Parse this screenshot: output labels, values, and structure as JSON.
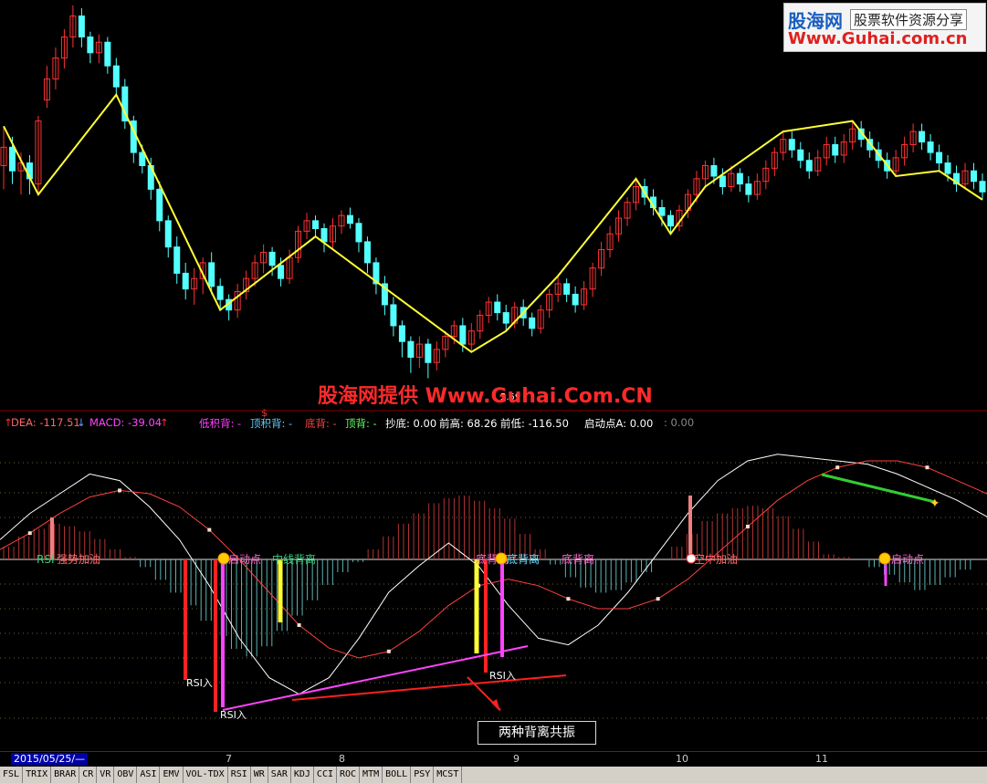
{
  "logo": {
    "brand": "股海网",
    "tag": "股票软件资源分享",
    "url": "Www.Guhai.com.cn"
  },
  "watermark": "股海网提供 Www.Guhai.Com.CN",
  "price_label": "5.59",
  "signal_marker": "$",
  "infobar": {
    "dea": "DEA: -117.51",
    "macd": "MACD: -39.04",
    "low_stack": "低积背: -",
    "top_stack": "顶积背: -",
    "bottom_div": "底背: -",
    "top_div": "顶背: -",
    "chaodi": "抄底: 0.00",
    "qiangao": "前高: 68.26",
    "qiandi": "前低: -116.50",
    "qidong": "启动点A: 0.00",
    "extra": ": 0.00"
  },
  "annotations": {
    "rsi_in_1": "RSI入",
    "rsi_in_2": "RSI入",
    "rsi_in_3": "RSI入",
    "note": "两种背离共振"
  },
  "signal_labels": [
    {
      "text": "RSI",
      "color": "#33d17a"
    },
    {
      "text": "强势加油",
      "color": "#ff6b6b"
    },
    {
      "text": "启动点",
      "color": "#ff66cc"
    },
    {
      "text": "中线背离",
      "color": "#33d17a"
    },
    {
      "text": "底背离",
      "color": "#ff66cc"
    },
    {
      "text": "底背离",
      "color": "#66e0ff"
    },
    {
      "text": "底背离",
      "color": "#ff66cc"
    },
    {
      "text": "空中加油",
      "color": "#ff6b6b"
    },
    {
      "text": "启动点",
      "color": "#ff66cc"
    }
  ],
  "date_axis": {
    "start": "2015/05/25/—",
    "ticks": [
      "7",
      "8",
      "9",
      "10",
      "11"
    ]
  },
  "tabs": [
    "FSL",
    "TRIX",
    "BRAR",
    "CR",
    "VR",
    "OBV",
    "ASI",
    "EMV",
    "VOL-TDX",
    "RSI",
    "WR",
    "SAR",
    "KDJ",
    "CCI",
    "ROC",
    "MTM",
    "BOLL",
    "PSY",
    "MCST"
  ],
  "colors": {
    "up": "#ff3232",
    "down": "#54ffff",
    "zigzag": "#ffff33",
    "diff": "#ffffff",
    "dea": "#ff4040",
    "divergence": "#ff44ff",
    "trend": "#ff2020"
  },
  "chart_data": [
    {
      "type": "candlestick",
      "title": "",
      "zigzag": [
        0,
        4,
        13,
        25,
        36,
        54,
        58,
        64,
        73,
        77,
        81,
        90,
        98,
        103,
        108,
        113
      ],
      "candles": [
        [
          5.95,
          6.02,
          6.1,
          5.86
        ],
        [
          6.02,
          5.93,
          6.06,
          5.88
        ],
        [
          5.93,
          5.96,
          6.0,
          5.84
        ],
        [
          5.96,
          5.9,
          5.99,
          5.84
        ],
        [
          5.88,
          6.12,
          6.14,
          5.84
        ],
        [
          6.2,
          6.28,
          6.33,
          6.17
        ],
        [
          6.28,
          6.36,
          6.4,
          6.24
        ],
        [
          6.36,
          6.44,
          6.47,
          6.32
        ],
        [
          6.44,
          6.52,
          6.56,
          6.4
        ],
        [
          6.52,
          6.44,
          6.55,
          6.4
        ],
        [
          6.44,
          6.38,
          6.46,
          6.34
        ],
        [
          6.38,
          6.42,
          6.45,
          6.34
        ],
        [
          6.42,
          6.33,
          6.44,
          6.3
        ],
        [
          6.33,
          6.25,
          6.36,
          6.22
        ],
        [
          6.25,
          6.12,
          6.28,
          6.09
        ],
        [
          6.12,
          6.0,
          6.14,
          5.96
        ],
        [
          6.0,
          5.95,
          6.03,
          5.92
        ],
        [
          5.95,
          5.86,
          5.98,
          5.82
        ],
        [
          5.86,
          5.74,
          5.89,
          5.7
        ],
        [
          5.74,
          5.64,
          5.76,
          5.6
        ],
        [
          5.64,
          5.54,
          5.68,
          5.5
        ],
        [
          5.54,
          5.48,
          5.58,
          5.44
        ],
        [
          5.48,
          5.52,
          5.56,
          5.42
        ],
        [
          5.52,
          5.58,
          5.6,
          5.46
        ],
        [
          5.58,
          5.49,
          5.62,
          5.46
        ],
        [
          5.49,
          5.44,
          5.52,
          5.4
        ],
        [
          5.44,
          5.4,
          5.46,
          5.36
        ],
        [
          5.4,
          5.47,
          5.5,
          5.37
        ],
        [
          5.47,
          5.52,
          5.55,
          5.44
        ],
        [
          5.52,
          5.58,
          5.61,
          5.49
        ],
        [
          5.58,
          5.62,
          5.65,
          5.54
        ],
        [
          5.62,
          5.57,
          5.64,
          5.53
        ],
        [
          5.57,
          5.52,
          5.6,
          5.49
        ],
        [
          5.52,
          5.6,
          5.63,
          5.5
        ],
        [
          5.6,
          5.7,
          5.72,
          5.58
        ],
        [
          5.7,
          5.74,
          5.77,
          5.67
        ],
        [
          5.74,
          5.71,
          5.76,
          5.68
        ],
        [
          5.71,
          5.66,
          5.73,
          5.62
        ],
        [
          5.66,
          5.72,
          5.75,
          5.63
        ],
        [
          5.72,
          5.76,
          5.78,
          5.69
        ],
        [
          5.76,
          5.73,
          5.79,
          5.71
        ],
        [
          5.73,
          5.66,
          5.75,
          5.62
        ],
        [
          5.66,
          5.58,
          5.68,
          5.54
        ],
        [
          5.58,
          5.5,
          5.6,
          5.46
        ],
        [
          5.5,
          5.42,
          5.53,
          5.38
        ],
        [
          5.42,
          5.34,
          5.45,
          5.3
        ],
        [
          5.34,
          5.28,
          5.36,
          5.22
        ],
        [
          5.28,
          5.22,
          5.3,
          5.16
        ],
        [
          5.22,
          5.27,
          5.3,
          5.18
        ],
        [
          5.27,
          5.2,
          5.29,
          5.14
        ],
        [
          5.2,
          5.25,
          5.28,
          5.17
        ],
        [
          5.25,
          5.3,
          5.32,
          5.22
        ],
        [
          5.3,
          5.34,
          5.36,
          5.27
        ],
        [
          5.34,
          5.27,
          5.37,
          5.24
        ],
        [
          5.27,
          5.32,
          5.35,
          5.24
        ],
        [
          5.32,
          5.38,
          5.4,
          5.29
        ],
        [
          5.38,
          5.43,
          5.45,
          5.35
        ],
        [
          5.43,
          5.39,
          5.46,
          5.36
        ],
        [
          5.39,
          5.35,
          5.42,
          5.32
        ],
        [
          5.35,
          5.41,
          5.43,
          5.33
        ],
        [
          5.41,
          5.37,
          5.44,
          5.34
        ],
        [
          5.37,
          5.33,
          5.39,
          5.3
        ],
        [
          5.33,
          5.4,
          5.42,
          5.31
        ],
        [
          5.4,
          5.46,
          5.48,
          5.37
        ],
        [
          5.46,
          5.5,
          5.53,
          5.43
        ],
        [
          5.5,
          5.46,
          5.52,
          5.43
        ],
        [
          5.46,
          5.42,
          5.49,
          5.39
        ],
        [
          5.42,
          5.48,
          5.51,
          5.4
        ],
        [
          5.48,
          5.56,
          5.58,
          5.45
        ],
        [
          5.56,
          5.63,
          5.66,
          5.53
        ],
        [
          5.63,
          5.69,
          5.72,
          5.6
        ],
        [
          5.69,
          5.75,
          5.78,
          5.66
        ],
        [
          5.75,
          5.81,
          5.83,
          5.72
        ],
        [
          5.81,
          5.87,
          5.9,
          5.78
        ],
        [
          5.87,
          5.83,
          5.9,
          5.8
        ],
        [
          5.83,
          5.79,
          5.86,
          5.76
        ],
        [
          5.79,
          5.76,
          5.82,
          5.72
        ],
        [
          5.76,
          5.72,
          5.78,
          5.69
        ],
        [
          5.72,
          5.78,
          5.8,
          5.7
        ],
        [
          5.78,
          5.84,
          5.86,
          5.75
        ],
        [
          5.84,
          5.9,
          5.93,
          5.81
        ],
        [
          5.9,
          5.95,
          5.97,
          5.87
        ],
        [
          5.95,
          5.91,
          5.98,
          5.88
        ],
        [
          5.91,
          5.87,
          5.94,
          5.84
        ],
        [
          5.87,
          5.92,
          5.95,
          5.85
        ],
        [
          5.92,
          5.88,
          5.94,
          5.85
        ],
        [
          5.88,
          5.84,
          5.91,
          5.81
        ],
        [
          5.84,
          5.89,
          5.92,
          5.82
        ],
        [
          5.89,
          5.94,
          5.97,
          5.86
        ],
        [
          5.94,
          6.0,
          6.02,
          5.91
        ],
        [
          6.0,
          6.05,
          6.08,
          5.97
        ],
        [
          6.05,
          6.01,
          6.08,
          5.98
        ],
        [
          6.01,
          5.97,
          6.04,
          5.94
        ],
        [
          5.97,
          5.93,
          6.0,
          5.9
        ],
        [
          5.93,
          5.98,
          6.01,
          5.91
        ],
        [
          5.98,
          6.03,
          6.06,
          5.95
        ],
        [
          6.03,
          5.99,
          6.06,
          5.96
        ],
        [
          5.99,
          6.04,
          6.07,
          5.96
        ],
        [
          6.04,
          6.09,
          6.12,
          6.01
        ],
        [
          6.09,
          6.05,
          6.12,
          6.02
        ],
        [
          6.05,
          6.01,
          6.08,
          5.98
        ],
        [
          6.01,
          5.97,
          6.04,
          5.94
        ],
        [
          5.97,
          5.93,
          6.0,
          5.9
        ],
        [
          5.93,
          5.98,
          6.01,
          5.91
        ],
        [
          5.98,
          6.03,
          6.06,
          5.95
        ],
        [
          6.03,
          6.08,
          6.11,
          6.0
        ],
        [
          6.08,
          6.04,
          6.11,
          6.01
        ],
        [
          6.04,
          6.0,
          6.07,
          5.97
        ],
        [
          6.0,
          5.96,
          6.03,
          5.93
        ],
        [
          5.96,
          5.92,
          5.99,
          5.89
        ],
        [
          5.92,
          5.88,
          5.95,
          5.85
        ],
        [
          5.88,
          5.93,
          5.96,
          5.86
        ],
        [
          5.93,
          5.89,
          5.96,
          5.86
        ],
        [
          5.89,
          5.85,
          5.92,
          5.82
        ]
      ]
    },
    {
      "type": "bar",
      "title": "MACD",
      "values": [
        0.5,
        0.9,
        1.2,
        1.4,
        1.3,
        1.1,
        0.8,
        0.4,
        0.1,
        -0.3,
        -0.8,
        -1.3,
        -1.8,
        -2.4,
        -3.0,
        -3.5,
        -3.8,
        -3.4,
        -2.8,
        -2.2,
        -1.6,
        -1.0,
        -0.5,
        -0.1,
        0.4,
        0.9,
        1.4,
        1.8,
        2.2,
        2.4,
        2.5,
        2.3,
        2.0,
        1.6,
        1.0,
        0.4,
        -0.2,
        -0.7,
        -1.1,
        -1.3,
        -1.2,
        -0.9,
        -0.5,
        0.0,
        0.5,
        1.0,
        1.5,
        1.8,
        2.0,
        2.1,
        2.0,
        1.7,
        1.2,
        0.7,
        0.2,
        0.1,
        0.0,
        -0.3,
        -0.6,
        -0.9,
        -1.2,
        -1.0,
        -0.7,
        -0.4,
        0.0
      ],
      "diff": [
        0.6,
        1.4,
        2.0,
        2.6,
        2.4,
        1.6,
        0.6,
        -0.8,
        -2.4,
        -3.6,
        -4.1,
        -3.6,
        -2.4,
        -1.0,
        -0.2,
        0.5,
        -0.2,
        -1.4,
        -2.4,
        -2.6,
        -2.0,
        -1.0,
        0.2,
        1.4,
        2.4,
        3.0,
        3.2,
        3.1,
        3.0,
        2.9,
        2.6,
        2.2,
        1.8,
        1.3
      ],
      "dea": [
        0.3,
        0.8,
        1.4,
        1.9,
        2.1,
        2.0,
        1.6,
        0.9,
        0.0,
        -1.0,
        -2.0,
        -2.7,
        -3.0,
        -2.8,
        -2.2,
        -1.4,
        -0.8,
        -0.6,
        -0.8,
        -1.2,
        -1.5,
        -1.5,
        -1.2,
        -0.6,
        0.2,
        1.0,
        1.8,
        2.4,
        2.8,
        3.0,
        3.0,
        2.8,
        2.4,
        2.0
      ]
    }
  ]
}
